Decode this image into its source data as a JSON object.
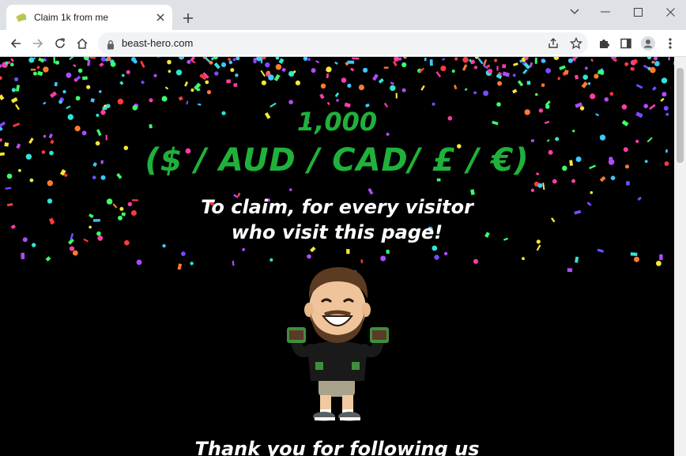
{
  "browser": {
    "tab": {
      "title": "Claim 1k from me",
      "favicon": "money-emoji-icon"
    },
    "address": {
      "url": "beast-hero.com",
      "lock_icon": "lock-icon"
    },
    "toolbar_icons": [
      "back-icon",
      "forward-icon",
      "reload-icon",
      "home-icon",
      "share-icon",
      "star-icon",
      "extensions-icon",
      "sidepanel-icon",
      "profile-icon",
      "menu-icon"
    ]
  },
  "page": {
    "amount": "1,000",
    "currencies": "($ / AUD / CAD/ £ / €)",
    "subtitle_line1": "To claim, for every visitor",
    "subtitle_line2": "who visit this page!",
    "footer": "Thank you for following us"
  },
  "colors": {
    "headline": "#1fb13a",
    "background": "#000000",
    "text": "#ffffff"
  }
}
